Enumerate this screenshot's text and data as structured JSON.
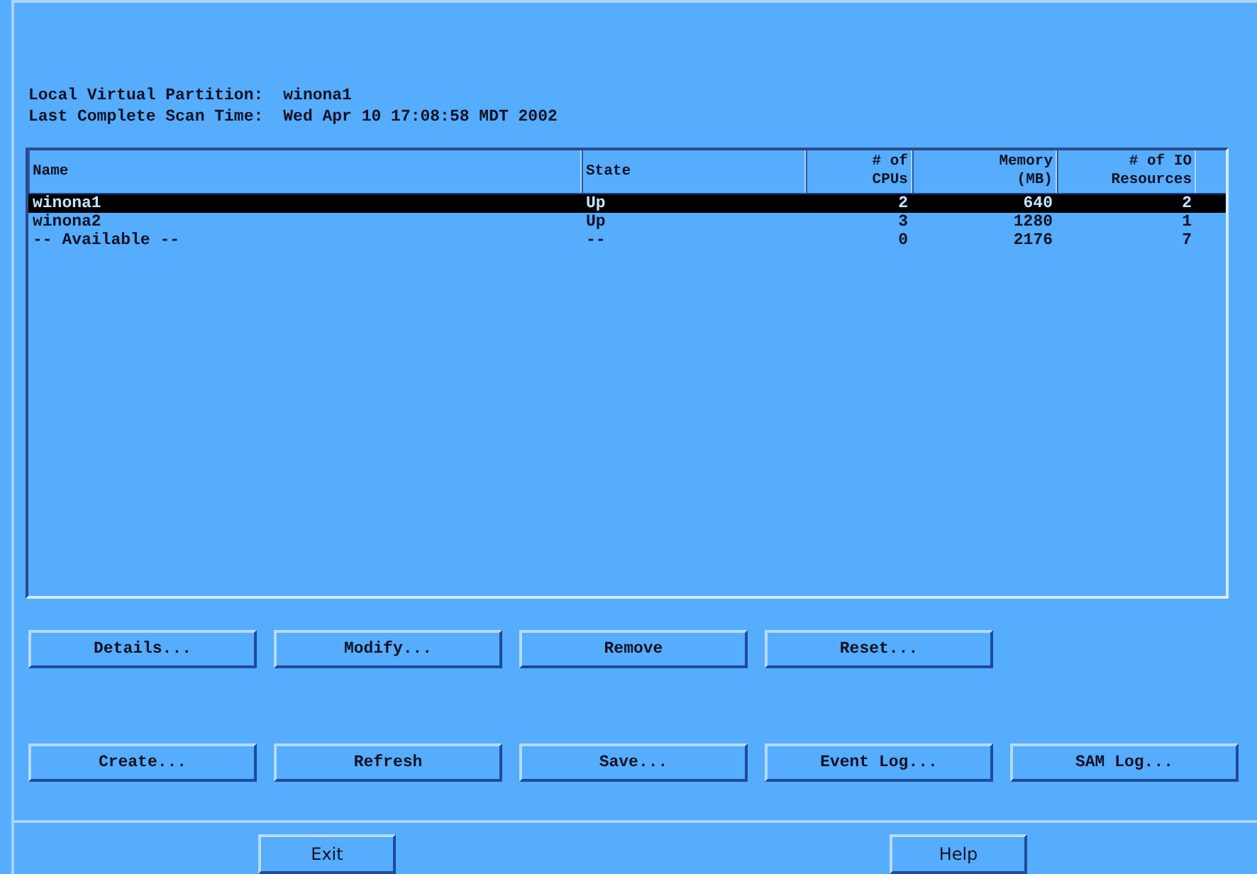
{
  "info": [
    {
      "label": "Local Virtual Partition:",
      "value": "winona1"
    },
    {
      "label": "Last Complete Scan Time:",
      "value": "Wed Apr 10 17:08:58 MDT 2002"
    }
  ],
  "table": {
    "columns": [
      {
        "lines": [
          "Name"
        ],
        "kind": "text"
      },
      {
        "lines": [
          "State"
        ],
        "kind": "text"
      },
      {
        "lines": [
          "# of",
          "CPUs"
        ],
        "kind": "number"
      },
      {
        "lines": [
          "Memory",
          "(MB)"
        ],
        "kind": "number"
      },
      {
        "lines": [
          "# of IO",
          "Resources"
        ],
        "kind": "number"
      }
    ],
    "rows": [
      {
        "cells": [
          "winona1",
          "Up",
          "2",
          "640",
          "2"
        ],
        "selected": true
      },
      {
        "cells": [
          "winona2",
          "Up",
          "3",
          "1280",
          "1"
        ],
        "selected": false
      },
      {
        "cells": [
          "-- Available --",
          "--",
          "0",
          "2176",
          "7"
        ],
        "selected": false
      }
    ]
  },
  "action_rows": [
    [
      "Details...",
      "Modify...",
      "Remove",
      "Reset..."
    ],
    [
      "Create...",
      "Refresh",
      "Save...",
      "Event Log...",
      "SAM Log..."
    ]
  ],
  "footer_buttons": [
    "Exit",
    "Help"
  ]
}
